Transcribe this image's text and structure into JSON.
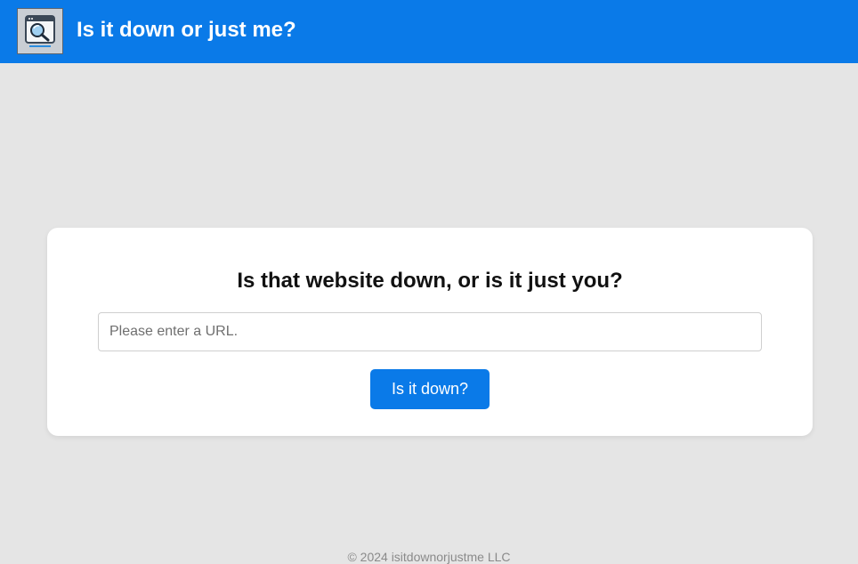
{
  "header": {
    "logo_icon": "magnifier-browser-icon",
    "title": "Is it down or just me?",
    "background_color": "#0a7ae8"
  },
  "main": {
    "heading": "Is that website down, or is it just you?",
    "url_input": {
      "value": "",
      "placeholder": "Please enter a URL."
    },
    "check_button_label": "Is it down?",
    "button_color": "#0a7ae8"
  },
  "footer": {
    "copyright": "© 2024 isitdownorjustme LLC"
  }
}
